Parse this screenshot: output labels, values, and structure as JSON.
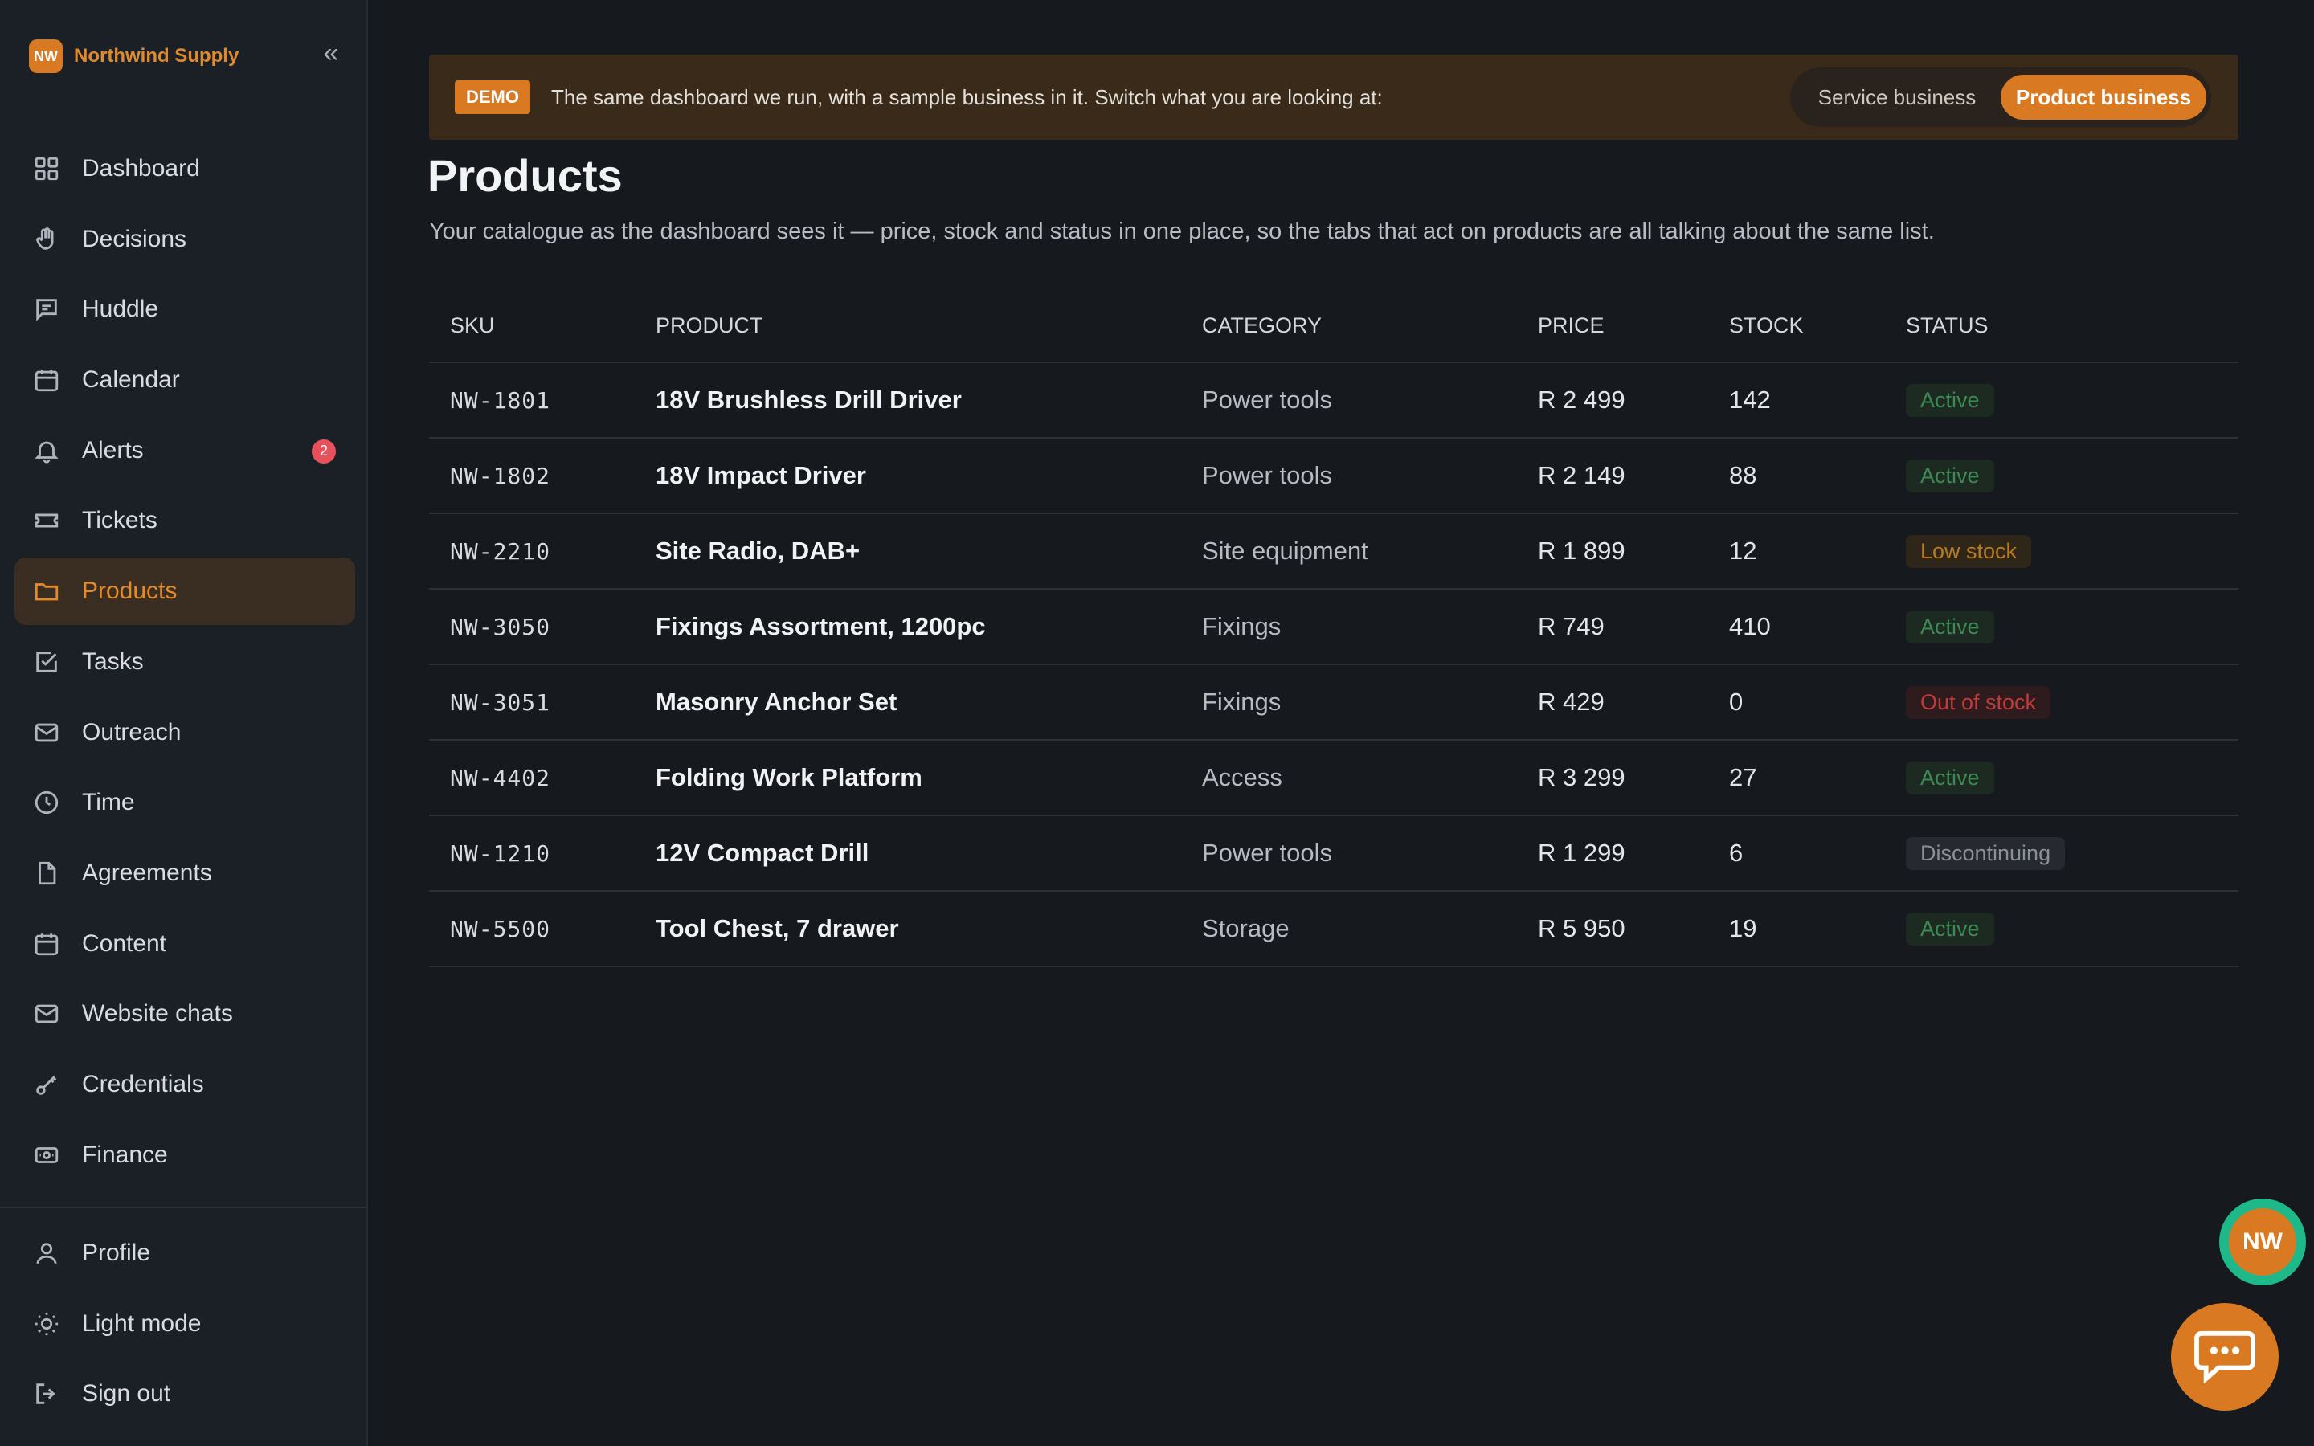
{
  "brand": {
    "logo": "NW",
    "name": "Northwind Supply",
    "collapse": "«"
  },
  "nav": [
    {
      "label": "Dashboard",
      "icon": "grid-icon"
    },
    {
      "label": "Decisions",
      "icon": "hand-icon"
    },
    {
      "label": "Huddle",
      "icon": "message-icon"
    },
    {
      "label": "Calendar",
      "icon": "calendar-icon"
    },
    {
      "label": "Alerts",
      "icon": "bell-icon",
      "badge": "2"
    },
    {
      "label": "Tickets",
      "icon": "ticket-icon"
    },
    {
      "label": "Products",
      "icon": "folder-icon",
      "active": true
    },
    {
      "label": "Tasks",
      "icon": "checkbox-icon"
    },
    {
      "label": "Outreach",
      "icon": "mail-icon"
    },
    {
      "label": "Time",
      "icon": "clock-icon"
    },
    {
      "label": "Agreements",
      "icon": "document-icon"
    },
    {
      "label": "Content",
      "icon": "calendar-icon"
    },
    {
      "label": "Website chats",
      "icon": "mail-icon"
    },
    {
      "label": "Credentials",
      "icon": "key-icon"
    },
    {
      "label": "Finance",
      "icon": "cash-icon"
    }
  ],
  "bottom_nav": [
    {
      "label": "Profile",
      "icon": "user-icon"
    },
    {
      "label": "Light mode",
      "icon": "sun-icon"
    },
    {
      "label": "Sign out",
      "icon": "logout-icon"
    }
  ],
  "banner": {
    "tag": "DEMO",
    "text": "The same dashboard we run, with a sample business in it. Switch what you are looking at:",
    "options": [
      "Service business",
      "Product business"
    ],
    "selected": "Product business"
  },
  "page": {
    "title": "Products",
    "subtitle": "Your catalogue as the dashboard sees it — price, stock and status in one place, so the tabs that act on products are all talking about the same list."
  },
  "table": {
    "headers": [
      "SKU",
      "PRODUCT",
      "CATEGORY",
      "PRICE",
      "STOCK",
      "STATUS"
    ],
    "rows": [
      {
        "sku": "NW-1801",
        "product": "18V Brushless Drill Driver",
        "category": "Power tools",
        "price": "R 2 499",
        "stock": "142",
        "status": "Active"
      },
      {
        "sku": "NW-1802",
        "product": "18V Impact Driver",
        "category": "Power tools",
        "price": "R 2 149",
        "stock": "88",
        "status": "Active"
      },
      {
        "sku": "NW-2210",
        "product": "Site Radio, DAB+",
        "category": "Site equipment",
        "price": "R 1 899",
        "stock": "12",
        "status": "Low stock"
      },
      {
        "sku": "NW-3050",
        "product": "Fixings Assortment, 1200pc",
        "category": "Fixings",
        "price": "R 749",
        "stock": "410",
        "status": "Active"
      },
      {
        "sku": "NW-3051",
        "product": "Masonry Anchor Set",
        "category": "Fixings",
        "price": "R 429",
        "stock": "0",
        "status": "Out of stock"
      },
      {
        "sku": "NW-4402",
        "product": "Folding Work Platform",
        "category": "Access",
        "price": "R 3 299",
        "stock": "27",
        "status": "Active"
      },
      {
        "sku": "NW-1210",
        "product": "12V Compact Drill",
        "category": "Power tools",
        "price": "R 1 299",
        "stock": "6",
        "status": "Discontinuing"
      },
      {
        "sku": "NW-5500",
        "product": "Tool Chest, 7 drawer",
        "category": "Storage",
        "price": "R 5 950",
        "stock": "19",
        "status": "Active"
      }
    ]
  },
  "floating": {
    "avatar": "NW",
    "chat_icon": "chat-bubble-icon"
  },
  "colors": {
    "accent": "#d97a22",
    "active": "#3d8a55",
    "low": "#b97a1f",
    "out": "#c23a3a"
  }
}
